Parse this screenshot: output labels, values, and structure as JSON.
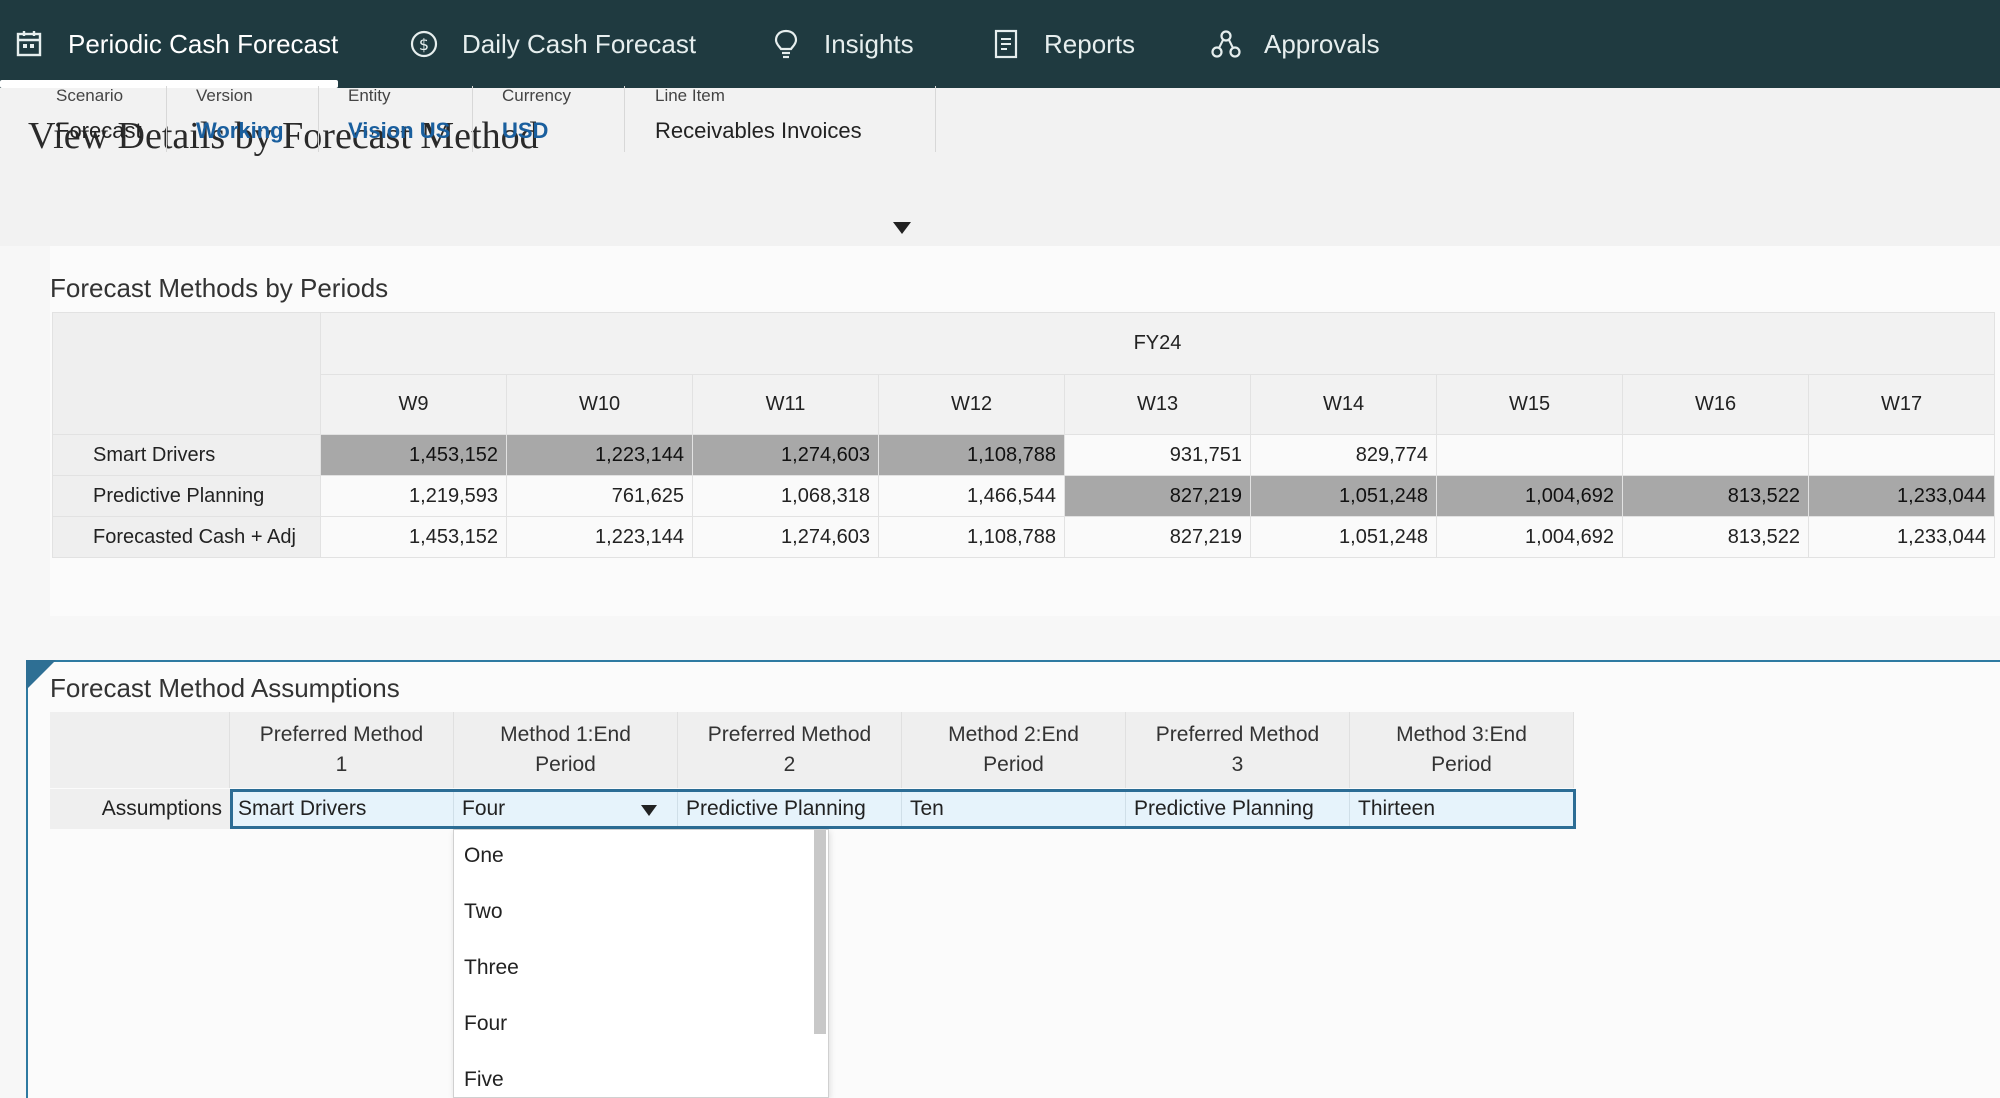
{
  "nav": {
    "tabs": [
      {
        "label": "Periodic Cash Forecast",
        "icon": "calendar-icon",
        "active": true
      },
      {
        "label": "Daily Cash Forecast",
        "icon": "currency-icon",
        "active": false
      },
      {
        "label": "Insights",
        "icon": "lightbulb-icon",
        "active": false
      },
      {
        "label": "Reports",
        "icon": "report-icon",
        "active": false
      },
      {
        "label": "Approvals",
        "icon": "approvals-icon",
        "active": false
      }
    ]
  },
  "page": {
    "title": "View Details by Forecast Method"
  },
  "pov": [
    {
      "label": "Scenario",
      "value": "Forecast"
    },
    {
      "label": "Version",
      "value": "Working"
    },
    {
      "label": "Entity",
      "value": "Vision US"
    },
    {
      "label": "Currency",
      "value": "USD"
    },
    {
      "label": "Line Item",
      "value": "Receivables Invoices"
    }
  ],
  "methods_grid": {
    "title": "Forecast Methods by Periods",
    "year": "FY24",
    "columns": [
      "W9",
      "W10",
      "W11",
      "W12",
      "W13",
      "W14",
      "W15",
      "W16",
      "W17"
    ],
    "rows": [
      {
        "label": "Smart Drivers",
        "values": [
          "1,453,152",
          "1,223,144",
          "1,274,603",
          "1,108,788",
          "931,751",
          "829,774",
          "",
          "",
          ""
        ],
        "highlight": [
          true,
          true,
          true,
          true,
          false,
          false,
          false,
          false,
          false
        ]
      },
      {
        "label": "Predictive Planning",
        "values": [
          "1,219,593",
          "761,625",
          "1,068,318",
          "1,466,544",
          "827,219",
          "1,051,248",
          "1,004,692",
          "813,522",
          "1,233,044"
        ],
        "highlight": [
          false,
          false,
          false,
          false,
          true,
          true,
          true,
          true,
          true
        ]
      },
      {
        "label": "Forecasted Cash + Adj",
        "values": [
          "1,453,152",
          "1,223,144",
          "1,274,603",
          "1,108,788",
          "827,219",
          "1,051,248",
          "1,004,692",
          "813,522",
          "1,233,044"
        ],
        "highlight": [
          false,
          false,
          false,
          false,
          false,
          false,
          false,
          false,
          false
        ]
      }
    ]
  },
  "assumptions": {
    "title": "Forecast Method Assumptions",
    "row_label": "Assumptions",
    "headers": [
      [
        "Preferred Method",
        "1"
      ],
      [
        "Method 1:End",
        "Period"
      ],
      [
        "Preferred Method",
        "2"
      ],
      [
        "Method 2:End",
        "Period"
      ],
      [
        "Preferred Method",
        "3"
      ],
      [
        "Method 3:End",
        "Period"
      ]
    ],
    "values": [
      "Smart Drivers",
      "Four",
      "Predictive Planning",
      "Ten",
      "Predictive Planning",
      "Thirteen"
    ]
  },
  "dropdown": {
    "options": [
      "One",
      "Two",
      "Three",
      "Four",
      "Five"
    ]
  }
}
